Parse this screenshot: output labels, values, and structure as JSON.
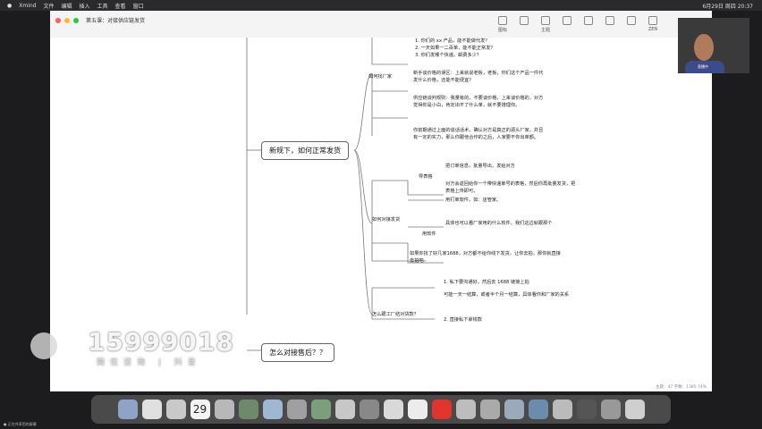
{
  "menubar": {
    "app": "Xmind",
    "menus": [
      "文件",
      "编辑",
      "插入",
      "工具",
      "查看",
      "窗口"
    ],
    "clock": "6月29日 周四 20:37"
  },
  "window": {
    "doc_title": "第五课：对接供应链发货"
  },
  "toolbar": {
    "items": [
      "图标",
      "",
      "主题",
      "",
      "",
      "",
      "",
      "",
      "",
      "ZEN"
    ]
  },
  "mindmap": {
    "topic_shipping": "新规下，如何正常发货",
    "topic_after_sales": "怎么对接售后？？",
    "branch_find_factory": "如何找厂家",
    "find_factory_items": [
      "1. 你们的 xx 产品，能不能做代发？",
      "2. 一天如果一二百单，能不能正常发？",
      "3. 你们发哪个快递，邮费多少？"
    ],
    "note_1": "新手谈价格的误区：上来就说老板，老板，你们这个产品一件代发什么价格，还能不能便宜？",
    "note_2": "供应链谈判规则：我量有的，不要谈价格，上来谈价格的，对方觉得你是小白，肯定出不了什么单，就不要搭理你。",
    "note_3": "你前期通过上面的谈话话术，确认对方是真正的源头厂家，并且有一定的实力，那么你跟他合作的之后，人家要不你出单额。",
    "branch_docking": "如何对接发货",
    "sub_table": "导表格",
    "table_items": [
      "把订单信息，批量导出，发给对方",
      "对方会返回给你一个带快递单号的表格，然后你再批量发货，把表格上传即可。"
    ],
    "sub_software": "用软件",
    "software_items": [
      "用打单软件，如：店管家。",
      "具体也可以看厂家用的什么软件，我们这边就跟那个"
    ],
    "note_1688": "如果你找了好几家1688，对方都不给你线下发货，让你去拍，那你就直接去拍吧",
    "branch_settlement": "怎么跟工厂结对货款？",
    "settlement_items": [
      "1. 私下要沟通好，然后去 1688 链接上拍",
      "可能一天一结算，或者半个月一结算，具体看你和厂家的关系",
      "2. 直接私下拿钱款"
    ]
  },
  "watermark": {
    "phone": "15999018",
    "subtitle": "微信咨询 | 抖音"
  },
  "status_bar": "主题：47  字数：1385  74%",
  "webcam": {
    "label": "直播中"
  },
  "dock": {
    "calendar_day": "29"
  },
  "caption": "● 正在共享您的屏幕"
}
